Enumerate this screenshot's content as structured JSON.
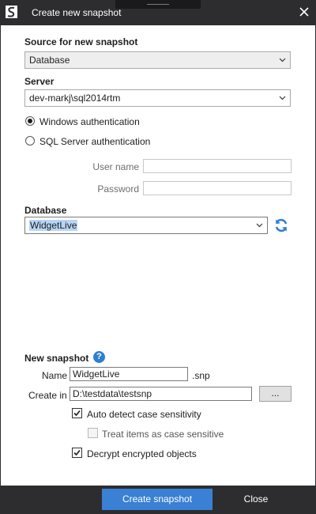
{
  "window": {
    "title": "Create new snapshot",
    "app_icon": "sql-compare-logo-icon",
    "close_icon": "close-icon"
  },
  "source": {
    "label": "Source for new snapshot",
    "selected": "Database"
  },
  "server": {
    "label": "Server",
    "selected": "dev-markj\\sql2014rtm"
  },
  "auth": {
    "windows_label": "Windows authentication",
    "windows_selected": true,
    "sql_label": "SQL Server authentication",
    "sql_selected": false,
    "username_label": "User name",
    "username_value": "",
    "password_label": "Password",
    "password_value": ""
  },
  "database": {
    "label": "Database",
    "selected": "WidgetLive",
    "refresh_icon": "refresh-icon"
  },
  "snapshot": {
    "section_label": "New snapshot",
    "help_icon": "help-icon",
    "help_glyph": "?",
    "name_label": "Name",
    "name_value": "WidgetLive",
    "name_suffix": ".snp",
    "create_in_label": "Create in",
    "create_in_value": "D:\\testdata\\testsnp",
    "browse_label": "...",
    "auto_detect_label": "Auto detect case sensitivity",
    "auto_detect_checked": true,
    "treat_case_label": "Treat items as case sensitive",
    "treat_case_checked": false,
    "treat_case_enabled": false,
    "decrypt_label": "Decrypt encrypted objects",
    "decrypt_checked": true
  },
  "footer": {
    "create_label": "Create snapshot",
    "close_label": "Close"
  },
  "colors": {
    "chrome": "#2d2d30",
    "accent": "#3a80d4",
    "selection": "#b7d6f7",
    "refresh": "#2f7fd1"
  }
}
